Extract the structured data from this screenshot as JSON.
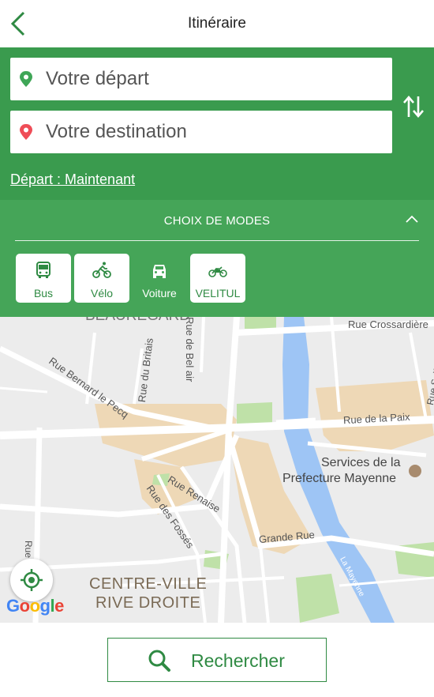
{
  "header": {
    "title": "Itinéraire",
    "back_icon": "chevron-left-icon"
  },
  "search": {
    "start_placeholder": "Votre départ",
    "destination_placeholder": "Votre destination",
    "depart_label": "Départ : Maintenant",
    "swap_icon": "swap-vertical-icon"
  },
  "modes": {
    "title": "CHOIX DE MODES",
    "items": [
      {
        "label": "Bus",
        "icon": "bus-icon",
        "selected": true
      },
      {
        "label": "Vélo",
        "icon": "bicycle-icon",
        "selected": true
      },
      {
        "label": "Voiture",
        "icon": "car-icon",
        "selected": false
      },
      {
        "label": "VELITUL",
        "icon": "ebike-icon",
        "selected": true
      }
    ]
  },
  "map": {
    "labels": {
      "quarter_top": "BEAUREGARD",
      "rue_bel_air": "Rue de Bel air",
      "rue_crossardiere": "Rue Crossardière",
      "rue_britais": "Rue du Britais",
      "rue_bernard": "Rue Bernard le Pecq",
      "rue_solferino": "Rue Solférino",
      "rue_paix": "Rue de la Paix",
      "services_1": "Services de la",
      "services_2": "Prefecture Mayenne",
      "rue_renaise": "Rue Renaise",
      "rue_fosses": "Rue des Fossés",
      "grande_rue": "Grande Rue",
      "rue_left": "Rue",
      "la_mayenne": "La Mayenne",
      "centre_1": "CENTRE-VILLE",
      "centre_2": "RIVE DROITE"
    },
    "logo_text": "Google",
    "colors": {
      "river": "#9ec5f5",
      "district": "#eed8b6",
      "park": "#bfe1a8",
      "road": "#ffffff"
    }
  },
  "bottom": {
    "search_label": "Rechercher",
    "search_icon": "magnifier-icon"
  },
  "colors": {
    "primary": "#3a9b4e",
    "modes_bg": "#45a558",
    "accent_text": "#2f8a43"
  }
}
